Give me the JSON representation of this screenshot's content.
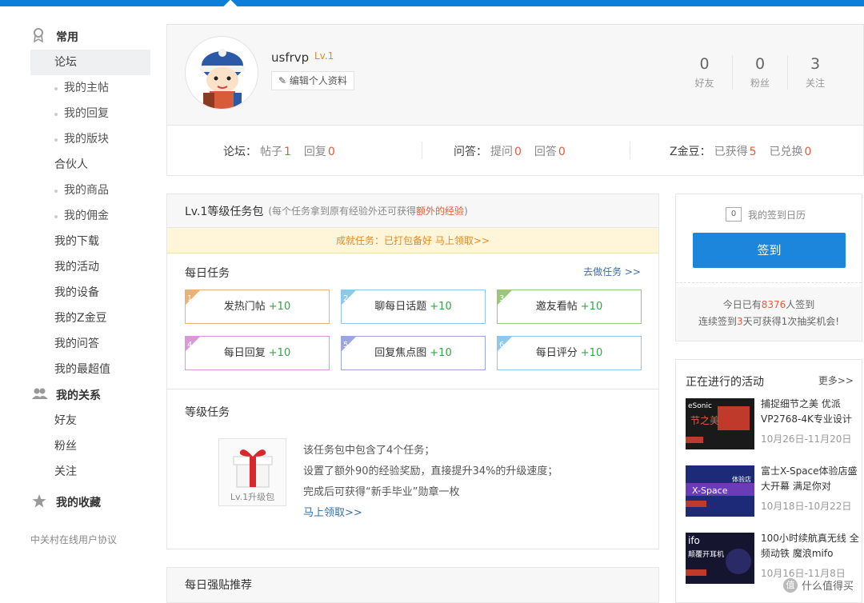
{
  "sidebar": {
    "sections": [
      {
        "label": "常用",
        "icon": "badge-icon"
      },
      {
        "label": "我的关系",
        "icon": "people-icon"
      },
      {
        "label": "我的收藏",
        "icon": "star-icon"
      }
    ],
    "forum": "论坛",
    "forum_items": [
      "我的主帖",
      "我的回复",
      "我的版块"
    ],
    "partner": "合伙人",
    "partner_items": [
      "我的商品",
      "我的佣金"
    ],
    "main_items": [
      "我的下载",
      "我的活动",
      "我的设备",
      "我的Z金豆",
      "我的问答",
      "我的最超值"
    ],
    "relation_items": [
      "好友",
      "粉丝",
      "关注"
    ],
    "agreement": "中关村在线用户协议"
  },
  "profile": {
    "username": "usfrvp",
    "level": "Lv.1",
    "edit_label": "编辑个人资料",
    "stats": [
      {
        "value": "0",
        "label": "好友"
      },
      {
        "value": "0",
        "label": "粉丝"
      },
      {
        "value": "3",
        "label": "关注"
      }
    ],
    "forum_label": "论坛：",
    "forum_posts_label": "帖子",
    "forum_posts": "1",
    "forum_replies_label": "回复",
    "forum_replies": "0",
    "qa_label": "问答：",
    "qa_ask_label": "提问",
    "qa_ask": "0",
    "qa_answer_label": "回答",
    "qa_answer": "0",
    "bean_label": "Z金豆：",
    "bean_got_label": "已获得",
    "bean_got": "5",
    "bean_used_label": "已兑换",
    "bean_used": "0"
  },
  "tasks": {
    "title": "Lv.1等级任务包",
    "note_pre": "(每个任务拿到原有经验外还可获得",
    "note_hl": "额外的经验",
    "note_post": ")",
    "achievement": "成就任务：已打包备好  马上领取>>",
    "daily_title": "每日任务",
    "goto": "去做任务 >>",
    "items": [
      {
        "num": "1",
        "label": "发热门帖",
        "points": "+10",
        "color": "#e8b27a"
      },
      {
        "num": "2",
        "label": "聊每日话题",
        "points": "+10",
        "color": "#8fc8e8"
      },
      {
        "num": "3",
        "label": "邀友看帖",
        "points": "+10",
        "color": "#9bc77a"
      },
      {
        "num": "4",
        "label": "每日回复",
        "points": "+10",
        "color": "#d79ad6"
      },
      {
        "num": "5",
        "label": "回复焦点图",
        "points": "+10",
        "color": "#9aa6dc"
      },
      {
        "num": "6",
        "label": "每日评分",
        "points": "+10",
        "color": "#8fc8e8"
      }
    ],
    "grade_title": "等级任务",
    "gift_caption": "Lv.1升级包",
    "desc": [
      "该任务包中包含了4个任务；",
      "设置了额外90的经验奖励，直接提升34%的升级速度；",
      "完成后可获得“新手毕业”勋章一枚"
    ],
    "claim": "马上领取>>"
  },
  "recommend_title": "每日强贴推荐",
  "sign": {
    "calendar_label": "我的签到日历",
    "calendar_num": "0",
    "button": "签到",
    "today_pre": "今日已有",
    "today_count": "8376",
    "today_post": "人签到",
    "streak_pre": "连续签到",
    "streak_days": "3",
    "streak_post": "天可获得1次抽奖机会!"
  },
  "activities": {
    "title": "正在进行的活动",
    "more": "更多>>",
    "items": [
      {
        "title": "捕捉细节之美 优派VP2768-4K专业设计",
        "date": "10月26日-11月20日",
        "thumb_text": "eSonic 节之美"
      },
      {
        "title": "富士X-Space体验店盛大开幕 满足你对",
        "date": "10月18日-10月22日",
        "thumb_text": "X-Space 体验店"
      },
      {
        "title": "100小时续航真无线 全频动铁 魔浪mifo",
        "date": "10月16日-11月8日",
        "thumb_text": "ifo 颠覆开耳机"
      }
    ]
  },
  "watermark": "什么值得买",
  "colors": {
    "accent": "#0d7fd8",
    "highlight": "#e25c3c",
    "positive": "#39a34a"
  }
}
